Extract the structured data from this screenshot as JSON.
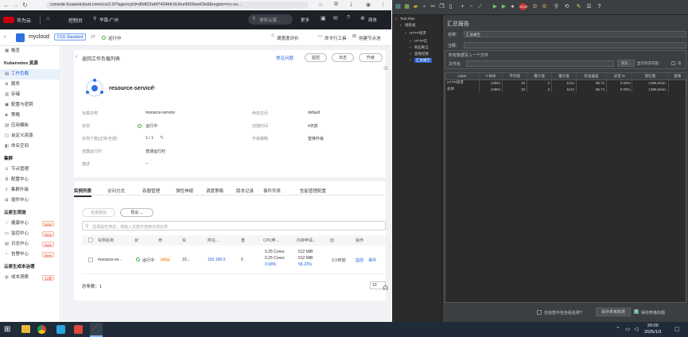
{
  "browser": {
    "url": "console.huaweicloud.com/cce2.0/?agencyId=d0df22ebf7434bfc9c9ce9600ee63e8&region=cn-so..."
  },
  "header": {
    "brand": "华为云",
    "console": "控制台",
    "region": "华南-广州",
    "search_placeholder": "搜索云服...",
    "more": "更多",
    "lang": "简体"
  },
  "app": {
    "cluster": "mycloud",
    "edition": "CCE Standard",
    "status": "运行中",
    "survey": "满意度评价",
    "cmd_tool": "命令行工具",
    "create_node": "创建节点池"
  },
  "sidebar": {
    "items": [
      {
        "label": "概览",
        "icon": "overview-icon",
        "sec": false
      },
      {
        "label": "Kubernetes 资源",
        "sec": true
      },
      {
        "label": "工作负载",
        "icon": "workload-icon",
        "active": true
      },
      {
        "label": "服务",
        "icon": "service-icon"
      },
      {
        "label": "存储",
        "icon": "storage-icon"
      },
      {
        "label": "配置与密钥",
        "icon": "config-icon"
      },
      {
        "label": "策略",
        "icon": "policy-icon"
      },
      {
        "label": "应用模板",
        "icon": "template-icon"
      },
      {
        "label": "自定义资源",
        "icon": "crd-icon"
      },
      {
        "label": "命名空间",
        "icon": "namespace-icon"
      },
      {
        "label": "集群",
        "sec": true
      },
      {
        "label": "节点管理",
        "icon": "node-icon"
      },
      {
        "label": "配置中心",
        "icon": "settings-icon"
      },
      {
        "label": "集群升级",
        "icon": "upgrade-icon"
      },
      {
        "label": "插件中心",
        "icon": "plugin-icon"
      },
      {
        "label": "云原生观测",
        "sec": true
      },
      {
        "label": "健康中心",
        "icon": "health-icon",
        "badge": "New"
      },
      {
        "label": "监控中心",
        "icon": "monitor-icon",
        "badge": "New"
      },
      {
        "label": "日志中心",
        "icon": "log-icon",
        "badge": "New"
      },
      {
        "label": "告警中心",
        "icon": "alarm-icon",
        "badge": "New"
      },
      {
        "label": "云原生成本治理",
        "sec": true
      },
      {
        "label": "成本洞察",
        "icon": "cost-icon",
        "badge": "公测"
      }
    ]
  },
  "page": {
    "back": "返回工作负载列表",
    "faq": "常见问题",
    "monitor": "监控",
    "log": "日志",
    "upgrade": "升级",
    "name": "resource-service"
  },
  "details": [
    {
      "k": "负载名称",
      "v": "resource-service",
      "k2": "命名空间",
      "v2": "default"
    },
    {
      "k": "状态",
      "v": "运行中",
      "k2": "创建时间",
      "v2": "4天前"
    },
    {
      "k": "实例个数(正常/全部)",
      "v": "1 / 1",
      "k2": "升级策略",
      "v2": "替换升级"
    },
    {
      "k": "容器运行时",
      "v": "普通运行时",
      "k2": "",
      "v2": ""
    },
    {
      "k": "描述",
      "v": "--",
      "k2": "",
      "v2": ""
    }
  ],
  "tabs": [
    "实例列表",
    "访问方式",
    "容器管理",
    "弹性伸缩",
    "调度策略",
    "版本记录",
    "事件列表",
    "性能管理配置"
  ],
  "toolbar": {
    "batch_delete": "批量删除",
    "export": "导出",
    "filter_placeholder": "选择属性筛选，或输入关键字搜索实例名称"
  },
  "table": {
    "headers": [
      "实例名称",
      "状",
      "命",
      "实",
      "所在...",
      "重",
      "CPU申...",
      "内存申请...",
      "创",
      "操作"
    ],
    "row": {
      "name": "resource-se...",
      "status": "运行中",
      "ns": "defau",
      "inst": "10...",
      "node": "192.168.0.",
      "restarts": "0",
      "cpu": [
        "0.25 Cores",
        "0.25 Cores",
        "0.68%"
      ],
      "mem": [
        "512 MiB",
        "512 MiB",
        "58.22%"
      ],
      "created": "2小时前",
      "ops": [
        "监控",
        "事件"
      ]
    },
    "total": "总条数：1",
    "page_size": "10"
  },
  "jmeter": {
    "tree": [
      "Test Plan",
      "线程组",
      "HTTP请求",
      "HTTP信",
      "响应断言",
      "查看结果",
      "汇总报告"
    ],
    "title": "汇总报告",
    "name_label": "名称：",
    "name_value": "汇总报告",
    "comment_label": "注释：",
    "file_section": "所有数据写入一个文件",
    "file_label": "文件名",
    "browse": "浏览...",
    "log_label": "显示日志内容：",
    "errors": "仅",
    "headers": [
      "Label",
      "# 样本",
      "平均值",
      "最小值",
      "最大值",
      "标准偏差",
      "异常 %",
      "吞吐量",
      "接收"
    ],
    "rows": [
      [
        "HTTP请求",
        "14961",
        "33",
        "3",
        "1124",
        "85.71",
        "0.00%",
        "1398.6/sec",
        ""
      ],
      [
        "总体",
        "14961",
        "33",
        "3",
        "1124",
        "85.71",
        "0.00%",
        "1398.6/sec",
        ""
      ]
    ],
    "include_group": "在标签中包含组名称?",
    "save_table": "保存表格数据",
    "save_header": "保存表格标题"
  },
  "taskbar": {
    "time": "20:00",
    "date": "2025/1/3"
  }
}
